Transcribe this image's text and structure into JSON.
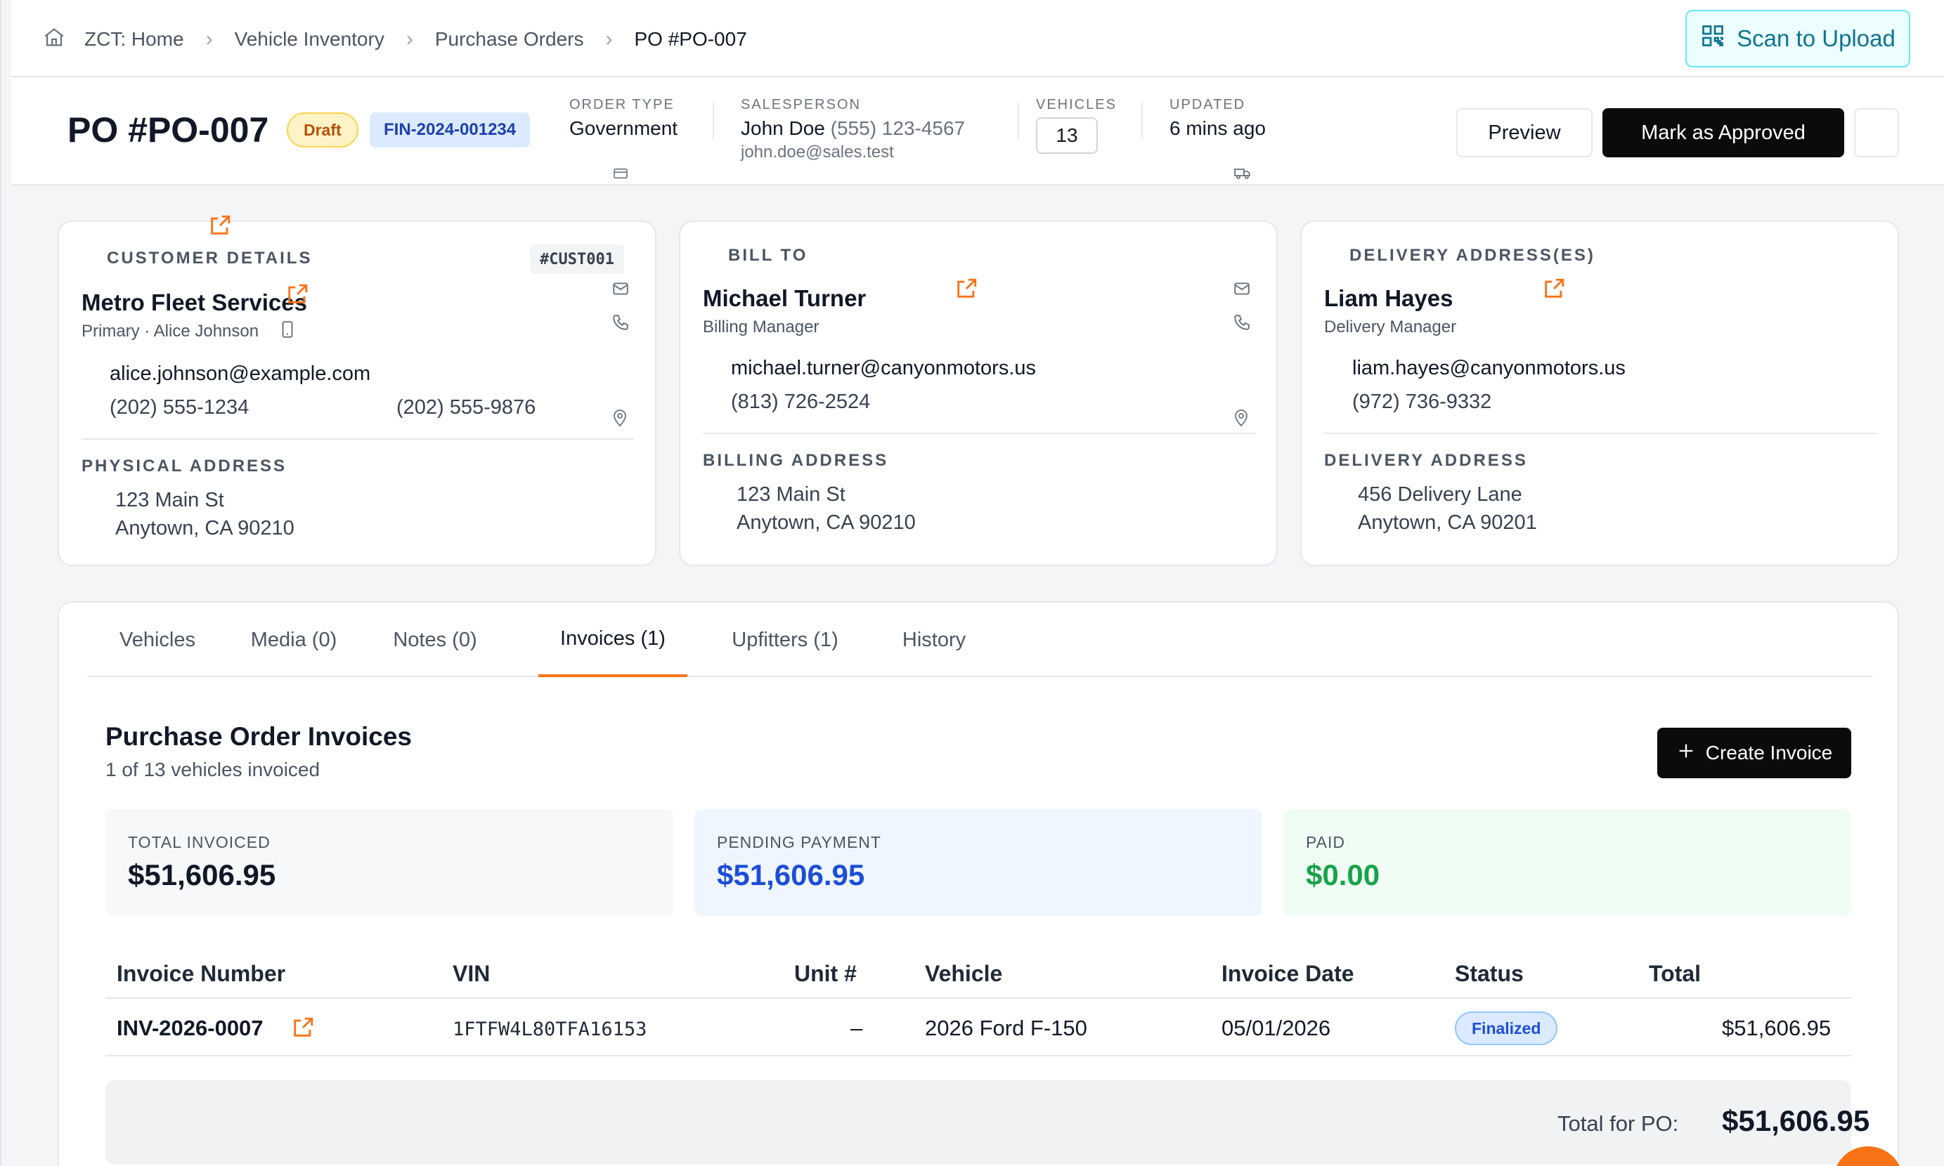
{
  "breadcrumb": {
    "items": [
      "ZCT: Home",
      "Vehicle Inventory",
      "Purchase Orders",
      "PO #PO-007"
    ]
  },
  "toolbar": {
    "scan_label": "Scan to Upload"
  },
  "header": {
    "title": "PO #PO-007",
    "status_badge": "Draft",
    "fin_badge": "FIN-2024-001234",
    "order_type_label": "ORDER TYPE",
    "order_type_value": "Government",
    "salesperson_label": "SALESPERSON",
    "salesperson_name": "John Doe",
    "salesperson_phone": "(555) 123-4567",
    "salesperson_email": "john.doe@sales.test",
    "vehicles_label": "VEHICLES",
    "vehicles_value": "13",
    "updated_label": "UPDATED",
    "updated_value": "6 mins ago",
    "preview_label": "Preview",
    "approve_label": "Mark as Approved"
  },
  "customer": {
    "label": "CUSTOMER DETAILS",
    "id": "#CUST001",
    "name": "Metro Fleet Services",
    "contact": "Primary · Alice Johnson",
    "email": "alice.johnson@example.com",
    "phone1": "(202) 555-1234",
    "phone2": "(202) 555-9876",
    "address_label": "PHYSICAL ADDRESS",
    "address_line1": "123 Main St",
    "address_line2": "Anytown, CA 90210"
  },
  "bill_to": {
    "label": "BILL TO",
    "name": "Michael Turner",
    "role": "Billing Manager",
    "email": "michael.turner@canyonmotors.us",
    "phone": "(813) 726-2524",
    "address_label": "BILLING ADDRESS",
    "address_line1": "123 Main St",
    "address_line2": "Anytown, CA 90210"
  },
  "delivery": {
    "label": "DELIVERY ADDRESS(ES)",
    "name": "Liam Hayes",
    "role": "Delivery Manager",
    "email": "liam.hayes@canyonmotors.us",
    "phone": "(972) 736-9332",
    "address_label": "DELIVERY ADDRESS",
    "address_line1": "456 Delivery Lane",
    "address_line2": "Anytown, CA 90201"
  },
  "tabs": [
    "Vehicles",
    "Media (0)",
    "Notes (0)",
    "Invoices (1)",
    "Upfitters (1)",
    "History"
  ],
  "active_tab": "Invoices (1)",
  "invoices": {
    "title": "Purchase Order Invoices",
    "subtitle": "1 of 13 vehicles invoiced",
    "create_label": "Create Invoice",
    "stats": {
      "total_label": "TOTAL INVOICED",
      "total_value": "$51,606.95",
      "pending_label": "PENDING PAYMENT",
      "pending_value": "$51,606.95",
      "paid_label": "PAID",
      "paid_value": "$0.00"
    },
    "columns": [
      "Invoice Number",
      "VIN",
      "Unit #",
      "Vehicle",
      "Invoice Date",
      "Status",
      "Total"
    ],
    "rows": [
      {
        "number": "INV-2026-0007",
        "vin": "1FTFW4L80TFA16153",
        "unit": "–",
        "vehicle": "2026 Ford F-150",
        "date": "05/01/2026",
        "status": "Finalized",
        "total": "$51,606.95"
      }
    ],
    "footer_label": "Total for PO:",
    "footer_value": "$51,606.95"
  },
  "colors": {
    "accent_orange": "#f97316",
    "scan_teal": "#0e7490",
    "pending_blue": "#1d4ed8",
    "paid_green": "#16a34a",
    "draft_amber": "#b45309"
  }
}
